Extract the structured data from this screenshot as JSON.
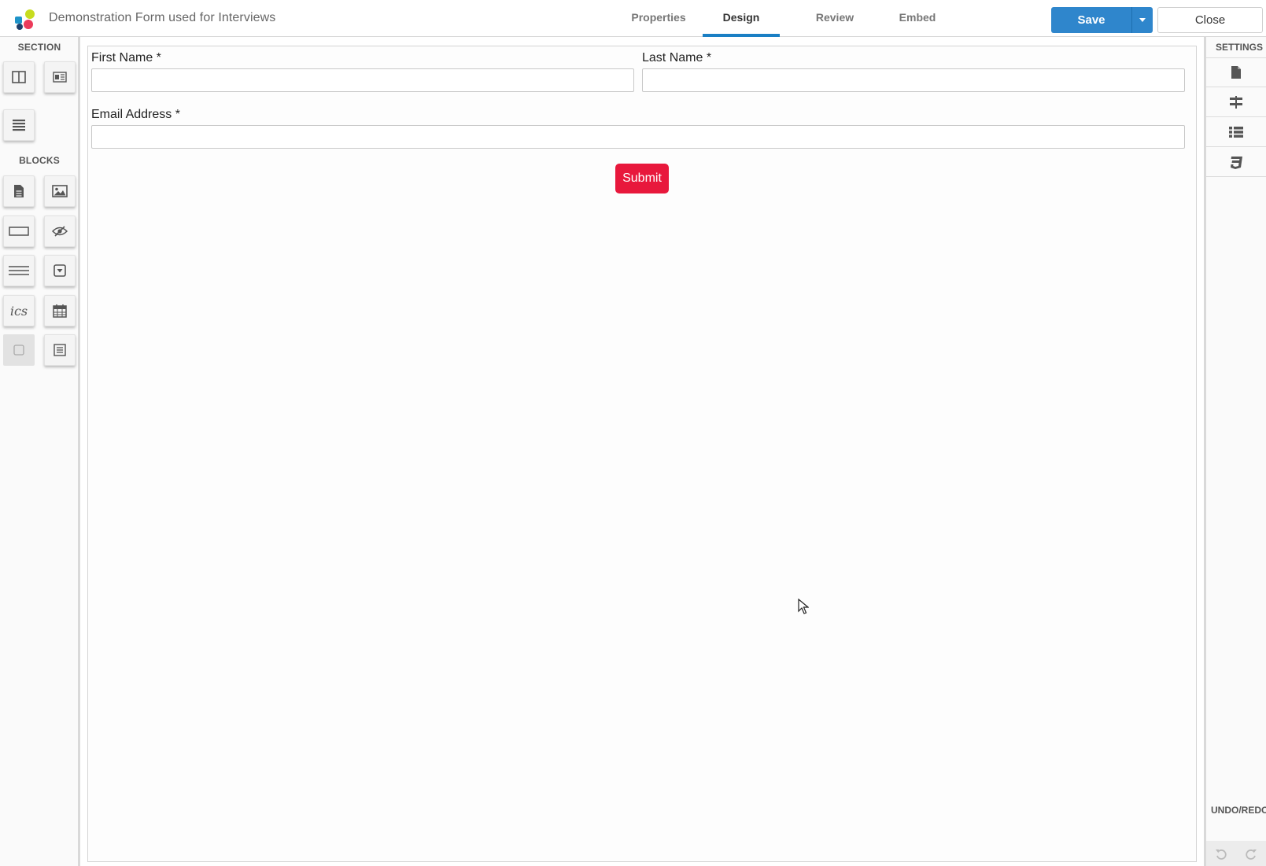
{
  "header": {
    "title": "Demonstration Form used for Interviews",
    "tabs": [
      {
        "label": "Properties",
        "active": false
      },
      {
        "label": "Design",
        "active": true
      },
      {
        "label": "Review",
        "active": false
      },
      {
        "label": "Embed",
        "active": false
      }
    ],
    "save_label": "Save",
    "close_label": "Close",
    "accent_color": "#1a7fc4"
  },
  "left_sidebar": {
    "section_heading": "SECTION",
    "blocks_heading": "BLOCKS",
    "section_tools": [
      "two-column-icon",
      "columns-text-icon",
      "rows-icon"
    ],
    "block_tools": [
      "document-icon",
      "image-icon",
      "text-input-icon",
      "hidden-field-icon",
      "paragraph-icon",
      "dropdown-icon",
      "signature-icon",
      "calendar-icon",
      "checkbox-icon",
      "list-icon"
    ]
  },
  "form": {
    "first_name_label": "First Name *",
    "last_name_label": "Last Name *",
    "email_label": "Email Address *",
    "submit_label": "Submit",
    "submit_color": "#e8183c"
  },
  "right_sidebar": {
    "settings_heading": "SETTINGS",
    "undo_redo_heading": "UNDO/REDO",
    "items": [
      "page-settings-icon",
      "layout-settings-icon",
      "list-settings-icon",
      "css-icon"
    ]
  }
}
